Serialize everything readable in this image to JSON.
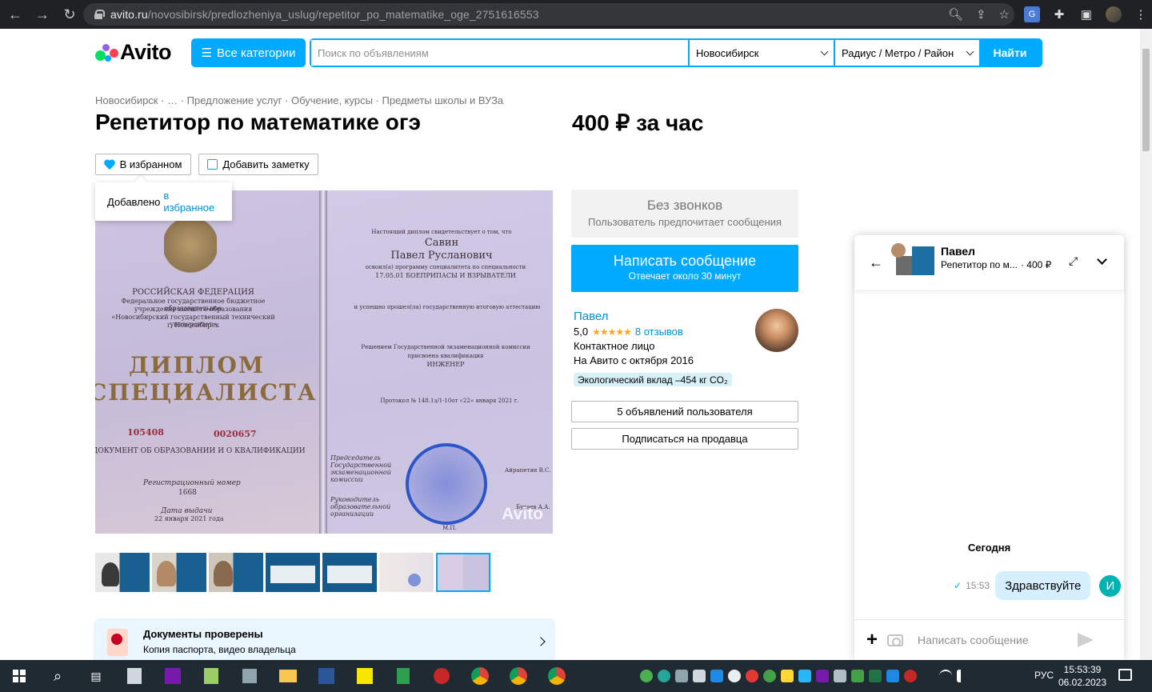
{
  "browser": {
    "url_domain": "avito.ru",
    "url_path": "/novosibirsk/predlozheniya_uslug/repetitor_po_matematike_oge_2751616553"
  },
  "header": {
    "logo": "Avito",
    "all_categories": "Все категории",
    "search_placeholder": "Поиск по объявлениям",
    "city": "Новосибирск",
    "radius": "Радиус / Метро / Район",
    "find": "Найти"
  },
  "breadcrumbs": [
    "Новосибирск",
    "…",
    "Предложение услуг",
    "Обучение, курсы",
    "Предметы школы и ВУЗа"
  ],
  "listing": {
    "title": "Репетитор по математике огэ",
    "price": "400 ₽ за час",
    "fav_label": "В избранном",
    "note_label": "Добавить заметку",
    "tooltip_prefix": "Добавлено",
    "tooltip_link": "в избранное"
  },
  "photo": {
    "line1": "РОССИЙСКАЯ ФЕДЕРАЦИЯ",
    "line2": "Федеральное государственное бюджетное образовательное",
    "line3": "учреждение высшего образования",
    "line4": "«Новосибирский государственный технический университет»",
    "line5": "г. Новосибирск",
    "diplom1": "ДИПЛОМ",
    "diplom2": "СПЕЦИАЛИСТА",
    "num1": "105408",
    "num2": "0020657",
    "doc": "ДОКУМЕНТ ОБ ОБРАЗОВАНИИ И О КВАЛИФИКАЦИИ",
    "reg_label": "Регистрационный номер",
    "reg_num": "1668",
    "date_label": "Дата выдачи",
    "date": "22 января 2021 года",
    "r1": "Настоящий диплом свидетельствует о том, что",
    "r_surname": "Савин",
    "r_name": "Павел Русланович",
    "r2": "освоил(а) программу специалитета по специальности",
    "r3": "17.05.01 БОЕПРИПАСЫ И ВЗРЫВАТЕЛИ",
    "r4": "и успешно прошел(ла) государственную итоговую аттестацию",
    "r5": "Решением Государственной экзаменационной комиссии",
    "r6": "присвоена квалификация",
    "r7": "ИНЖЕНЕР",
    "r8": "Протокол №  148.1з/1-10от «22»  января  2021 г.",
    "r9": "Председатель Государственной экзаменационной комиссии",
    "r10": "Айрапетян В.С.",
    "r11": "Руководитель образовательной организации",
    "r12": "Бутаев А.А.",
    "r13": "М.П.",
    "watermark": "Avito"
  },
  "docs": {
    "title": "Документы проверены",
    "subtitle": "Копия паспорта, видео владельца"
  },
  "sidebar": {
    "nocall_title": "Без звонков",
    "nocall_sub": "Пользователь предпочитает сообщения",
    "write_title": "Написать сообщение",
    "write_sub": "Отвечает около 30 минут",
    "seller_name": "Павел",
    "rating": "5,0",
    "stars": "★★★★★",
    "reviews": "8 отзывов",
    "contact": "Контактное лицо",
    "since": "На Авито с октября 2016",
    "eco": "Экологический вклад –454 кг CO₂",
    "ads_btn": "5 объявлений пользователя",
    "sub_btn": "Подписаться на продавца"
  },
  "chat": {
    "name": "Павел",
    "subtitle": "Репетитор по м...",
    "price": "· 400 ₽",
    "today": "Сегодня",
    "time": "15:53",
    "message": "Здравствуйте",
    "user_initial": "И",
    "placeholder": "Написать сообщение"
  },
  "taskbar": {
    "lang": "РУС",
    "time": "15:53:39",
    "date": "06.02.2023"
  },
  "colors": {
    "accent": "#00aaff",
    "link": "#0091d9",
    "star": "#ffa719"
  }
}
